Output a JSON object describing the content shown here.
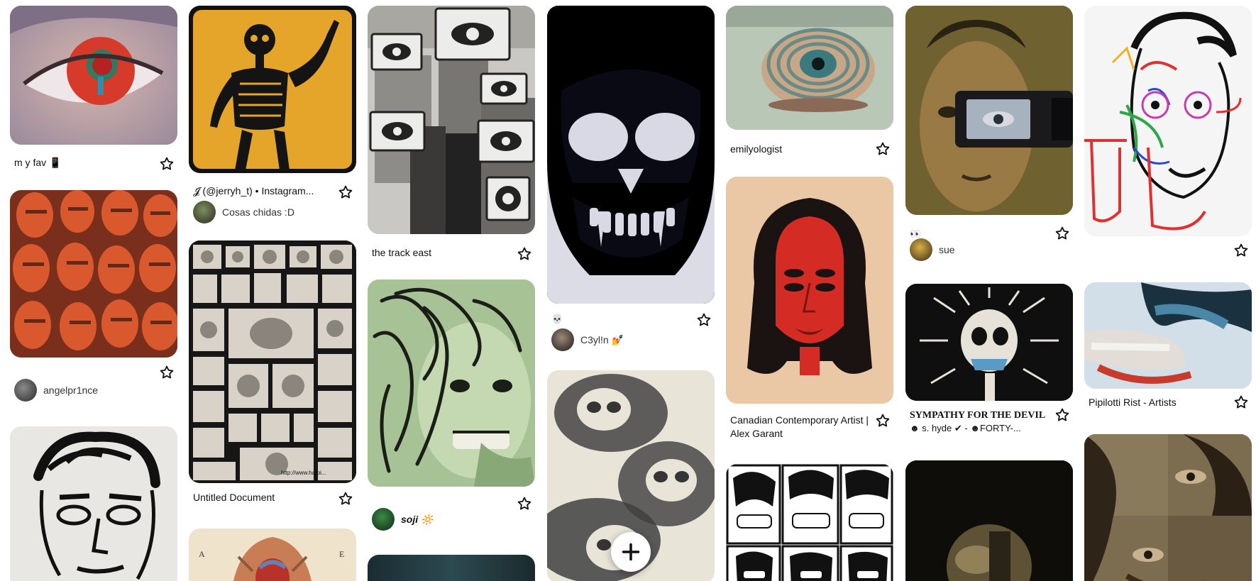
{
  "board": {
    "pins": {
      "p1": {
        "title": "m y fav 📱",
        "image": "red eye close-up"
      },
      "p2": {
        "user": "angelpr1nce",
        "image": "collage of faces in red tint"
      },
      "p3": {
        "image": "black ink drawing of a face"
      },
      "p4": {
        "title": "𝓙 (@jerryh_t) • Instagram...",
        "user": "Cosas chidas :D",
        "image": "skeleton on yellow"
      },
      "p5": {
        "title": "Untitled Document",
        "image": "black and white photo collage",
        "watermark": "http://www.harbi..."
      },
      "p6": {
        "image": "anatomical heart illustration",
        "letters": [
          "A",
          "E"
        ]
      },
      "p7": {
        "title": "the track east",
        "image": "building covered with eye signs"
      },
      "p8": {
        "user": "soji 🔆",
        "image": "green-tinted portrait with hair"
      },
      "p9": {
        "image": "dark teal photo"
      },
      "p10": {
        "title": "💀",
        "user": "C3yl!n 💅",
        "image": "black skull illustration"
      },
      "p11": {
        "image": "ghostly skulls"
      },
      "p12": {
        "title": "emilyologist",
        "image": "spiral eye"
      },
      "p13": {
        "title": "Canadian Contemporary Artist | Alex Garant",
        "image": "red face with doubled eyes"
      },
      "p14": {
        "image": "grid of grinning comic faces"
      },
      "p15": {
        "title": "👀",
        "user": "sue",
        "image": "camcorder over face"
      },
      "p16": {
        "title": "SYMPATHY FOR THE DEVIL",
        "subtitle": "☻ s. hyde ✔ - ☻FORTY-...",
        "image": "skull on black"
      },
      "p17": {
        "image": "dark portrait"
      },
      "p18": {
        "image": "colorful scribble portrait"
      },
      "p19": {
        "title": "Pipilotti Rist - Artists",
        "image": "blurred mouth close-up"
      },
      "p20": {
        "image": "collage of eyes and hair"
      }
    }
  },
  "fab": {
    "icon": "plus-icon"
  },
  "colors": {
    "text": "#111111",
    "background": "#ffffff",
    "star_stroke": "#111111"
  }
}
